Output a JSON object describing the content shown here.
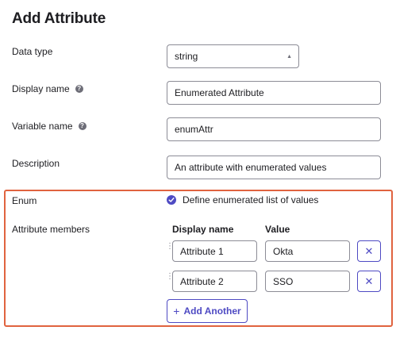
{
  "title": "Add Attribute",
  "fields": {
    "data_type": {
      "label": "Data type",
      "value": "string"
    },
    "display_name": {
      "label": "Display name",
      "value": "Enumerated Attribute"
    },
    "variable_name": {
      "label": "Variable name",
      "value": "enumAttr"
    },
    "description": {
      "label": "Description",
      "value": "An attribute with enumerated values"
    }
  },
  "enum": {
    "label": "Enum",
    "checkbox_label": "Define enumerated list of values",
    "checked": true
  },
  "members": {
    "label": "Attribute members",
    "col_display_name": "Display name",
    "col_value": "Value",
    "rows": [
      {
        "display_name": "Attribute 1",
        "value": "Okta"
      },
      {
        "display_name": "Attribute 2",
        "value": "SSO"
      }
    ],
    "add_label": "Add Another"
  },
  "colors": {
    "accent": "#4e4ac3",
    "highlight_border": "#e0633f"
  }
}
